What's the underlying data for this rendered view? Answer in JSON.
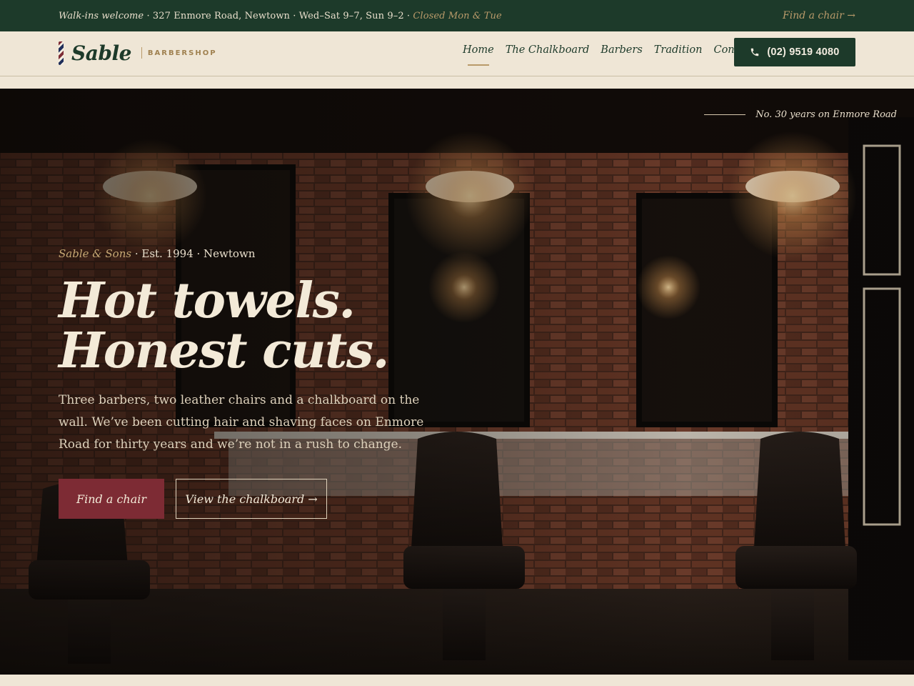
{
  "topbar": {
    "lead": "Walk-ins welcome",
    "address": " · 327 Enmore Road, Newtown · Wed–Sat 9–7, Sun 9–2 · ",
    "closed": "Closed Mon & Tue",
    "find_link": "Find a chair →"
  },
  "header": {
    "brand_name": "Sable",
    "brand_sub": "BARBERSHOP",
    "nav": [
      "Home",
      "The Chalkboard",
      "Barbers",
      "Tradition",
      "Contact"
    ],
    "active_nav": "Home",
    "phone": "(02) 9519 4080"
  },
  "hero": {
    "tagline": "No. 30 years on Enmore Road",
    "eyebrow_accent": "Sable & Sons",
    "eyebrow_rest": " · Est. 1994 · Newtown",
    "headline_line1": "Hot towels.",
    "headline_line2": "Honest cuts.",
    "lede": "Three barbers, two leather chairs and a chalkboard on the wall. We’ve been cutting hair and shaving faces on Enmore Road for thirty years and we’re not in a rush to change.",
    "primary_cta": "Find a chair",
    "secondary_cta": "View the chalkboard →"
  },
  "colors": {
    "forest": "#1d3a2a",
    "cream": "#efe6d6",
    "oxblood": "#7d2b34",
    "brass": "#b99a6a"
  },
  "icons": {
    "phone": "phone-icon",
    "pole": "barber-pole-icon"
  }
}
